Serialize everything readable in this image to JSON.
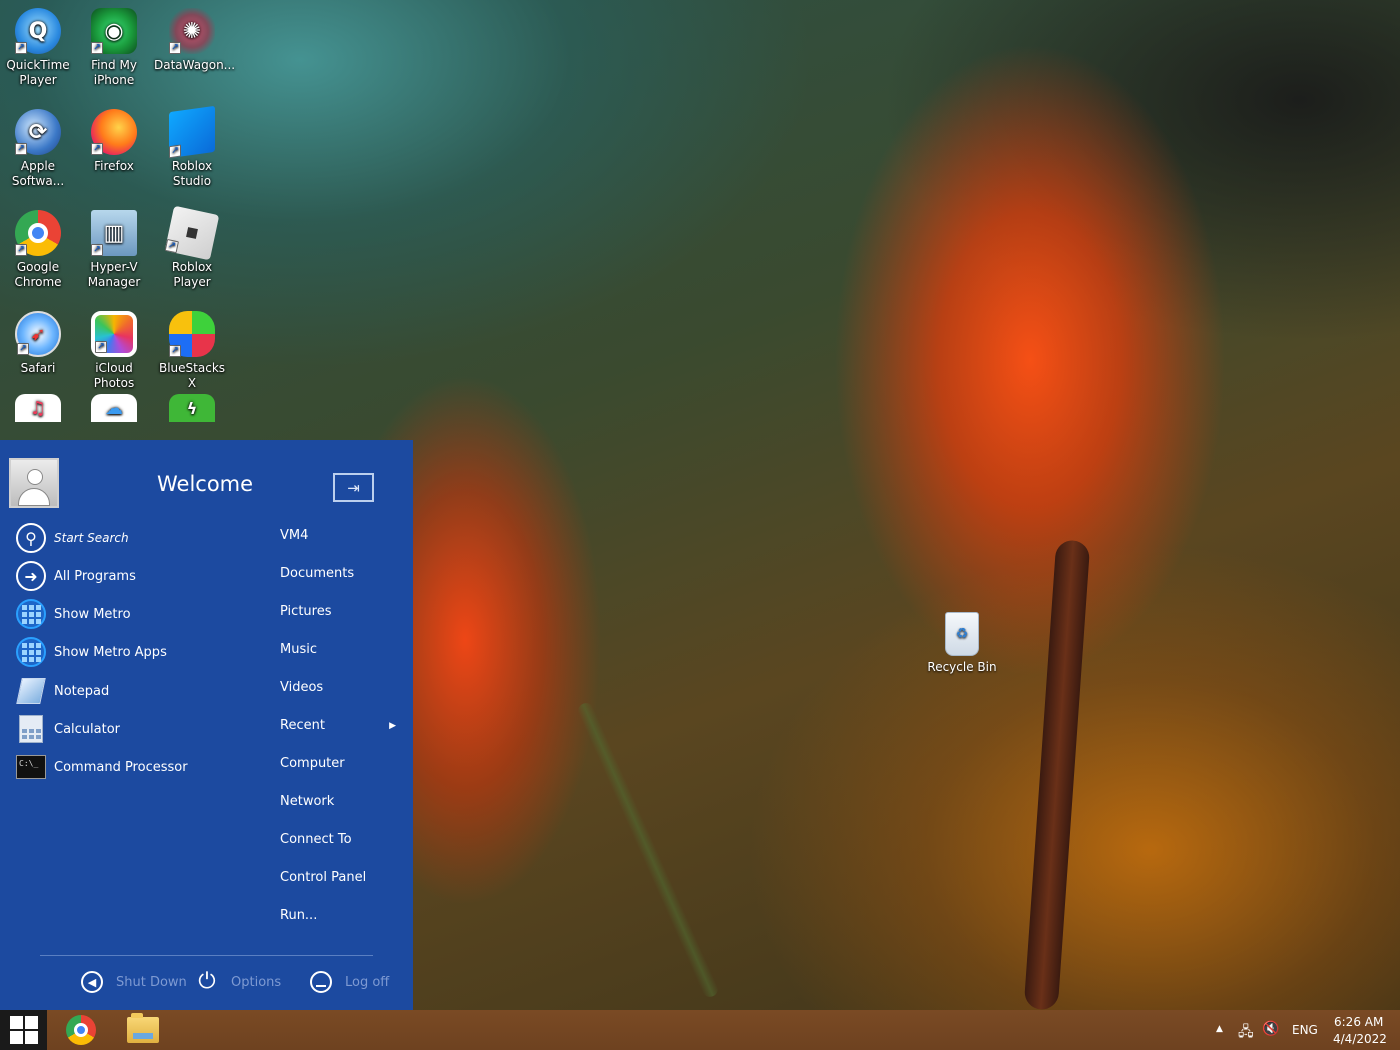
{
  "desktop": {
    "icons": [
      {
        "label": "QuickTime Player",
        "icon": "quicktime-icon"
      },
      {
        "label": "Find My iPhone",
        "icon": "find-my-iphone-icon"
      },
      {
        "label": "DataWagon...",
        "icon": "datawagon-icon"
      },
      {
        "label": "Apple Softwa...",
        "icon": "apple-software-update-icon"
      },
      {
        "label": "Firefox",
        "icon": "firefox-icon"
      },
      {
        "label": "Roblox Studio",
        "icon": "roblox-studio-icon"
      },
      {
        "label": "Google Chrome",
        "icon": "chrome-icon"
      },
      {
        "label": "Hyper-V Manager",
        "icon": "hyperv-manager-icon"
      },
      {
        "label": "Roblox Player",
        "icon": "roblox-player-icon"
      },
      {
        "label": "Safari",
        "icon": "safari-icon"
      },
      {
        "label": "iCloud Photos",
        "icon": "icloud-photos-icon"
      },
      {
        "label": "BlueStacks X",
        "icon": "bluestacks-icon"
      }
    ],
    "recycle_bin": {
      "label": "Recycle Bin"
    }
  },
  "start_menu": {
    "title": "Welcome",
    "pin_glyph": "⇥",
    "left_items": [
      {
        "label": "Start Search",
        "icon": "search-icon"
      },
      {
        "label": "All Programs",
        "icon": "arrow-right-icon"
      },
      {
        "label": "Show Metro",
        "icon": "metro-icon"
      },
      {
        "label": "Show Metro Apps",
        "icon": "metro-apps-icon"
      },
      {
        "label": "Notepad",
        "icon": "notepad-icon"
      },
      {
        "label": "Calculator",
        "icon": "calculator-icon"
      },
      {
        "label": "Command Processor",
        "icon": "command-prompt-icon"
      }
    ],
    "right_items": [
      "VM4",
      "Documents",
      "Pictures",
      "Music",
      "Videos",
      "Recent",
      "Computer",
      "Network",
      "Connect To",
      "Control Panel",
      "Run..."
    ],
    "footer": {
      "shutdown": "Shut Down",
      "options": "Options",
      "logoff": "Log off"
    }
  },
  "taskbar": {
    "pinned": [
      {
        "name": "Google Chrome",
        "icon": "chrome-icon"
      },
      {
        "name": "File Explorer",
        "icon": "file-explorer-icon"
      }
    ],
    "tray": {
      "language": "ENG",
      "time": "6:26 AM",
      "date": "4/4/2022"
    }
  },
  "colors": {
    "start_menu_bg": "#1c4aa0",
    "taskbar_bg": "#7a4a24",
    "footer_text": "#7e9ad2"
  }
}
